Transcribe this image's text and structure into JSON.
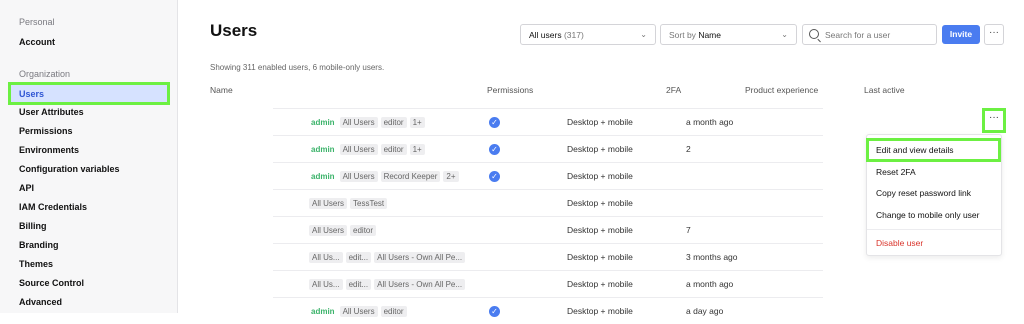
{
  "sidebar": {
    "personal_label": "Personal",
    "account": "Account",
    "organization_label": "Organization",
    "items": [
      "Users",
      "User Attributes",
      "Permissions",
      "Environments",
      "Configuration variables",
      "API",
      "IAM Credentials",
      "Billing",
      "Branding",
      "Themes",
      "Source Control",
      "Advanced"
    ]
  },
  "main": {
    "title": "Users",
    "summary": "Showing 311 enabled users, 6 mobile-only users.",
    "filter": {
      "label": "All users",
      "count": "(317)"
    },
    "sort": {
      "prefix": "Sort by",
      "value": "Name"
    },
    "search_placeholder": "Search for a user",
    "invite": "Invite",
    "more": "···"
  },
  "table": {
    "headers": [
      "Name",
      "Permissions",
      "2FA",
      "Product experience",
      "Last active"
    ],
    "rows": [
      {
        "tags": [
          "admin",
          "All Users",
          "editor",
          "1+"
        ],
        "twofa": true,
        "experience": "Desktop + mobile",
        "last_active": "a month ago"
      },
      {
        "tags": [
          "admin",
          "All Users",
          "editor",
          "1+"
        ],
        "twofa": true,
        "experience": "Desktop + mobile",
        "last_active": "2"
      },
      {
        "tags": [
          "admin",
          "All Users",
          "Record Keeper",
          "2+"
        ],
        "twofa": true,
        "experience": "Desktop + mobile",
        "last_active": ""
      },
      {
        "tags": [
          "All Users",
          "TessTest"
        ],
        "twofa": false,
        "experience": "Desktop + mobile",
        "last_active": ""
      },
      {
        "tags": [
          "All Users",
          "editor"
        ],
        "twofa": false,
        "experience": "Desktop + mobile",
        "last_active": "7"
      },
      {
        "tags": [
          "All Us...",
          "edit...",
          "All Users - Own All Pe..."
        ],
        "twofa": false,
        "experience": "Desktop + mobile",
        "last_active": "3 months ago"
      },
      {
        "tags": [
          "All Us...",
          "edit...",
          "All Users - Own All Pe..."
        ],
        "twofa": false,
        "experience": "Desktop + mobile",
        "last_active": "a month ago"
      },
      {
        "tags": [
          "admin",
          "All Users",
          "editor"
        ],
        "twofa": true,
        "experience": "Desktop + mobile",
        "last_active": "a day ago"
      }
    ]
  },
  "row_menu": {
    "trigger": "···",
    "items": [
      "Edit and view details",
      "Reset 2FA",
      "Copy reset password link",
      "Change to mobile only user"
    ],
    "danger": "Disable user"
  },
  "icons": {
    "check": "check-circle-icon",
    "search": "search-icon",
    "chevron": "chevron-down-icon",
    "more": "more-horizontal-icon"
  },
  "colors": {
    "accent": "#4a7cf0",
    "admin": "#3bb36a",
    "danger": "#d9342b",
    "highlight": "#6cf042"
  }
}
